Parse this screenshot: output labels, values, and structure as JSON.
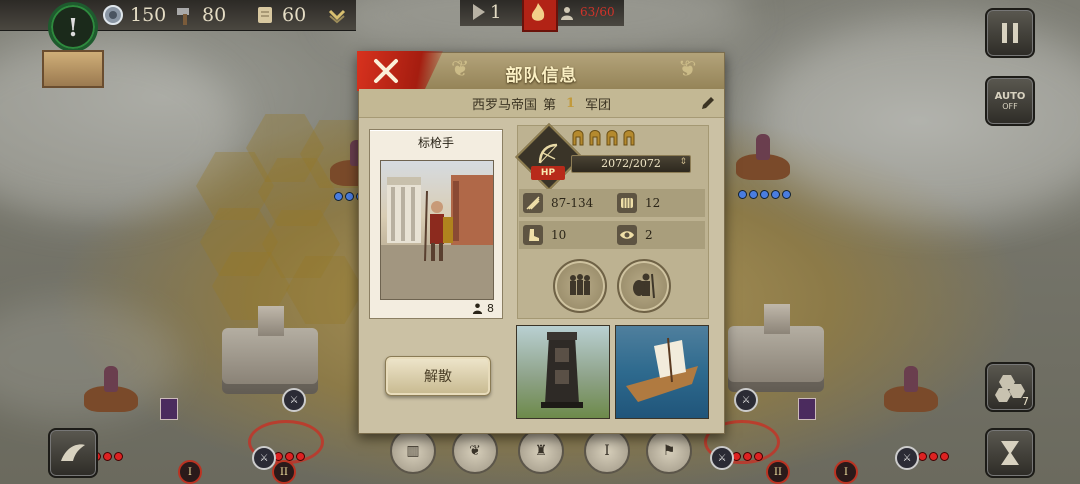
{
  "hud": {
    "alert_symbol": "!",
    "resources": [
      {
        "icon": "coin-icon",
        "value": "150"
      },
      {
        "icon": "hammer-icon",
        "value": "80"
      },
      {
        "icon": "scroll-icon",
        "value": "60"
      }
    ],
    "turn_count": "1",
    "population": "63/60"
  },
  "side_buttons": {
    "pause_icon": "pause-icon",
    "auto_label": "AUTO",
    "auto_state": "OFF",
    "hex_count": "7"
  },
  "dialog": {
    "title": "部队信息",
    "legion": {
      "nation": "西罗马帝国",
      "prefix": "第",
      "number": "1",
      "suffix": "军团"
    },
    "unit_name": "标枪手",
    "unit_count": "8",
    "hp": "2072/2072",
    "hp_label": "HP",
    "stars": 4,
    "stats": {
      "attack": "87-134",
      "defense": "12",
      "movement": "10",
      "vision": "2"
    },
    "disband_label": "解散"
  },
  "colors": {
    "accent_red": "#c0281a",
    "gold": "#c29a3a",
    "panel": "#cbc1a4"
  }
}
